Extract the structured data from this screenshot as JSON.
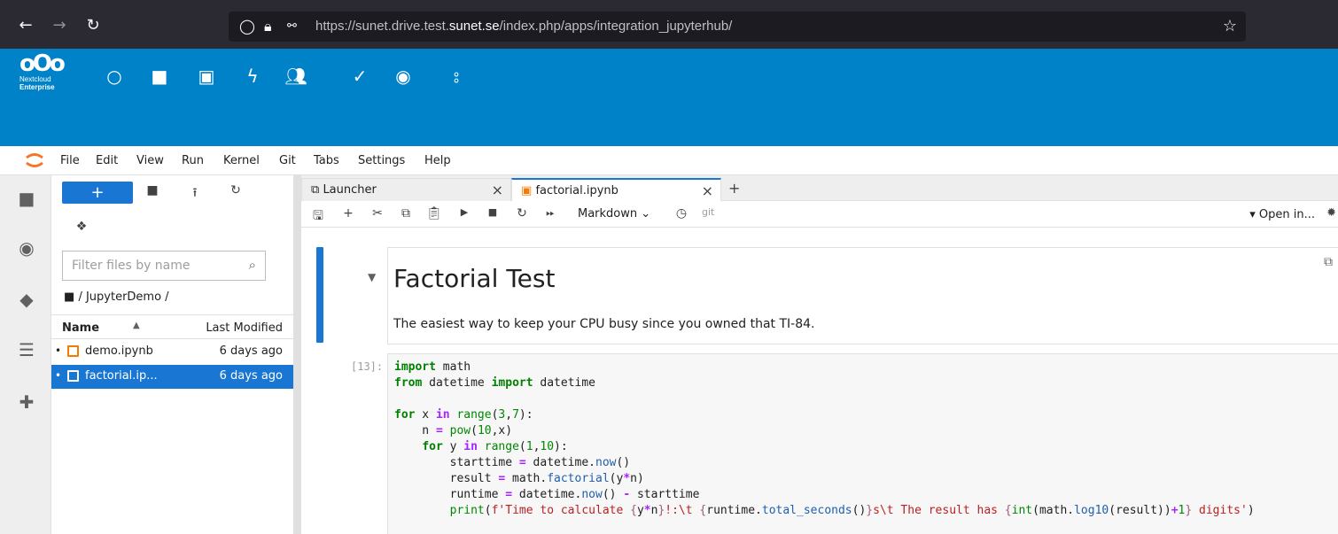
{
  "browser": {
    "url_prefix": "https://sunet.drive.test.",
    "url_domain": "sunet.se",
    "url_suffix": "/index.php/apps/integration_jupyterhub/"
  },
  "nextcloud": {
    "logo_line1": "Nextcloud",
    "logo_line2": "Enterprise",
    "brand_color": "#0082c9"
  },
  "jupyter": {
    "menu": [
      "File",
      "Edit",
      "View",
      "Run",
      "Kernel",
      "Git",
      "Tabs",
      "Settings",
      "Help"
    ],
    "filter_placeholder": "Filter files by name",
    "breadcrumb": "/ JupyterDemo /",
    "columns": {
      "name": "Name",
      "modified": "Last Modified"
    },
    "files": [
      {
        "name": "demo.ipynb",
        "modified": "6 days ago"
      },
      {
        "name": "factorial.ip...",
        "modified": "6 days ago"
      }
    ],
    "tabs": [
      {
        "label": "Launcher"
      },
      {
        "label": "factorial.ipynb"
      }
    ],
    "cell_type": "Markdown",
    "git_label": "git",
    "open_in": "Open in...",
    "heading": "Factorial Test",
    "paragraph": "The easiest way to keep your CPU busy since you owned that TI-84.",
    "prompt": "[13]:",
    "accent": "#1976d2"
  }
}
